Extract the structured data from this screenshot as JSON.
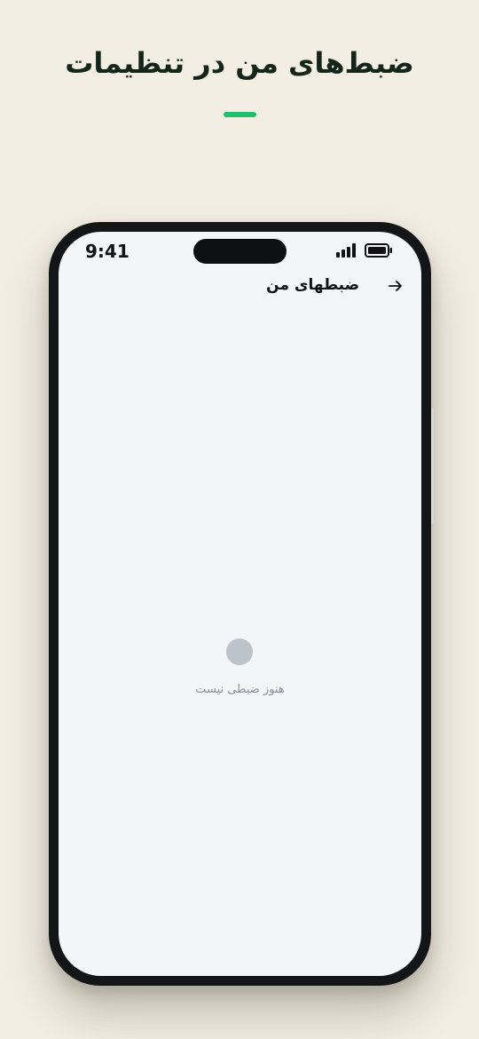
{
  "page": {
    "headline": "ضبط‌های من در تنظیمات"
  },
  "device": {
    "status_bar": {
      "time": "9:41",
      "signal_icon": "signal-icon",
      "battery_icon": "battery-icon"
    },
    "app_bar": {
      "title": "ضبطهای من",
      "back_icon": "arrow-right-icon"
    },
    "empty_state": {
      "message": "هنوز ضبطی نیست"
    }
  },
  "colors": {
    "background": "#f2eee4",
    "accent": "#1fc06b",
    "headline": "#14261a",
    "phone_frame": "#141517",
    "screen": "#f4f5f7",
    "empty_dot": "#bcc3ca",
    "empty_text": "#8a9099"
  }
}
